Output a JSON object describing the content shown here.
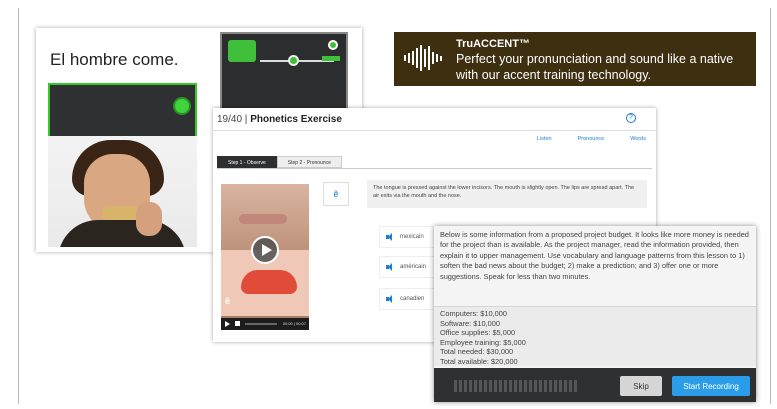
{
  "flashcard": {
    "phrase": "El hombre come."
  },
  "ad": {
    "brand": "TruACCENT™",
    "tagline": "Perfect your pronunciation and sound like a native with our accent training technology."
  },
  "phonetics": {
    "progress": "19/40",
    "title": "Phonetics Exercise",
    "help_label": "?",
    "links": [
      "Listen",
      "Pronounce",
      "Words"
    ],
    "tabs": [
      "Step 1 - Observe",
      "Step 2 - Pronounce"
    ],
    "active_tab": 0,
    "glyph": "ẽ",
    "description": "The tongue is pressed against the lower incisors. The mouth is slightly open. The lips are spread apart. The air exits via the mouth and the nose.",
    "words": [
      "mexicain",
      "américain",
      "canadien"
    ],
    "video_mark": "ẽ",
    "video_time": "00:00 | 00:07"
  },
  "task": {
    "prompt": "Below is some information from a proposed project budget. It looks like more money is needed for the project than is available. As the project manager, read the information provided, then explain it to upper management. Use vocabulary and language patterns from this lesson to 1) soften the bad news about the budget; 2) make a prediction; and 3) offer one or more suggestions. Speak for less than two minutes.",
    "budget": [
      "Computers: $10,000",
      "Software: $10,000",
      "Office supplies: $5,000",
      "Employee training: $5,000",
      "Total needed: $30,000",
      "Total available: $20,000"
    ],
    "skip_label": "Skip",
    "record_label": "Start Recording"
  },
  "colors": {
    "accent_green": "#38c82c",
    "record_blue": "#2b9de8",
    "ad_bg": "#3d2f10"
  }
}
